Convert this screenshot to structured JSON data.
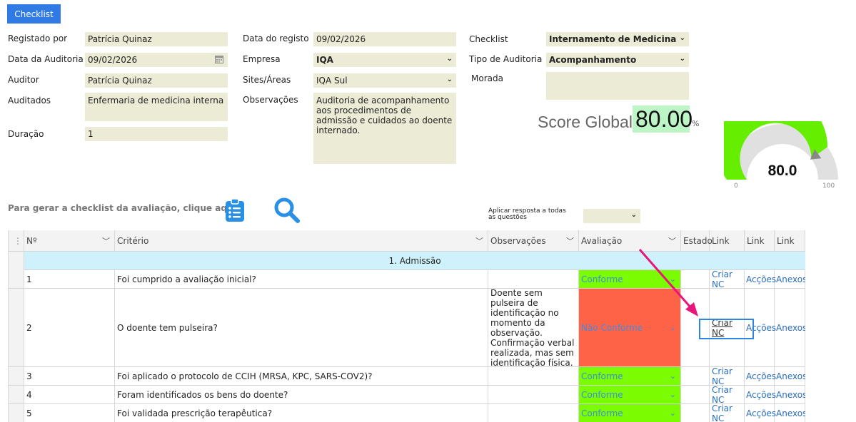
{
  "toolbar": {
    "checklist_button": "Checklist"
  },
  "form": {
    "registado_por": {
      "label": "Registado por",
      "value": "Patrícia Quinaz"
    },
    "data_auditoria": {
      "label": "Data da Auditoria",
      "value": "09/02/2026"
    },
    "auditor": {
      "label": "Auditor",
      "value": "Patrícia Quinaz"
    },
    "auditados": {
      "label": "Auditados",
      "value": "Enfermaria de medicina interna"
    },
    "duracao": {
      "label": "Duração",
      "value": "1"
    },
    "data_registo": {
      "label": "Data do registo",
      "value": "09/02/2026"
    },
    "empresa": {
      "label": "Empresa",
      "value": "IQA"
    },
    "sites": {
      "label": "Sites/Áreas",
      "value": "IQA Sul"
    },
    "observacoes": {
      "label": "Observações",
      "value": "Auditoria de acompanhamento aos procedimentos de admissão e cuidados ao doente internado."
    },
    "checklist": {
      "label": "Checklist",
      "value": "Internamento de Medicina"
    },
    "tipo_auditoria": {
      "label": "Tipo de Auditoria",
      "value": "Acompanhamento"
    },
    "morada": {
      "label": "Morada",
      "value": ""
    }
  },
  "score": {
    "label": "Score Global",
    "value": "80.00",
    "unit": "%",
    "gauge_value": "80.0",
    "gauge_level": 80,
    "gauge_min": "0",
    "gauge_max": "100",
    "gauge_fill_color": "#66ee00",
    "gauge_track_color": "#e0e0e0"
  },
  "actions": {
    "generate_label": "Para gerar a checklist da avaliação, clique aqui:",
    "apply_all_label": "Aplicar resposta a todas as questões",
    "apply_all_value": ""
  },
  "table": {
    "columns": [
      "Nº",
      "Critério",
      "Observações",
      "Avaliação",
      "Estado",
      "Link",
      "Link",
      "Link"
    ],
    "group": "1. Admissão",
    "rows": [
      {
        "n": "1",
        "criterio": "Foi cumprido a avaliação inicial?",
        "obs": "",
        "avaliacao": "Conforme",
        "estado": "",
        "criar": "Criar NC",
        "accoes": "Acções",
        "anexos": "Anexos"
      },
      {
        "n": "2",
        "criterio": "O doente tem pulseira?",
        "obs": "Doente sem pulseira de identificação no momento da observação. Confirmação verbal realizada, mas sem identificação física.",
        "avaliacao": "Não Conforme",
        "estado": "",
        "criar": "Criar NC",
        "accoes": "Acções",
        "anexos": "Anexos"
      },
      {
        "n": "3",
        "criterio": "Foi aplicado o protocolo de CCIH (MRSA, KPC, SARS-COV2)?",
        "obs": "",
        "avaliacao": "Conforme",
        "estado": "",
        "criar": "Criar NC",
        "accoes": "Acções",
        "anexos": "Anexos"
      },
      {
        "n": "4",
        "criterio": "Foram identificados os bens do doente?",
        "obs": "",
        "avaliacao": "Conforme",
        "estado": "",
        "criar": "Criar NC",
        "accoes": "Acções",
        "anexos": "Anexos"
      },
      {
        "n": "5",
        "criterio": "Foi validada prescrição terapêutica?",
        "obs": "",
        "avaliacao": "Conforme",
        "estado": "",
        "criar": "Criar NC",
        "accoes": "Acções",
        "anexos": "Anexos"
      }
    ]
  },
  "colors": {
    "field_bg": "#ecebd5",
    "conforme": "#7cfc00",
    "nao_conforme": "#ff6347",
    "group_row": "#cff1fb",
    "annotation_arrow": "#e8157a",
    "highlight_box": "#2f85e0"
  }
}
